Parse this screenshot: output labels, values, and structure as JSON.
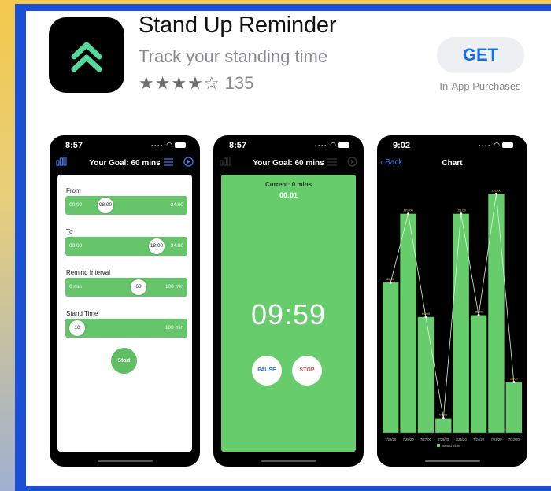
{
  "app": {
    "title": "Stand Up Reminder",
    "subtitle": "Track your standing time",
    "stars": "★★★★☆",
    "rating_count": "135",
    "get_label": "GET",
    "iap_label": "In-App Purchases",
    "icon": "double-chevron-up-icon",
    "icon_color": "#54d99a"
  },
  "screens": [
    {
      "status_time": "8:57",
      "nav_title": "Your Goal: 60 mins",
      "settings": [
        {
          "label": "From",
          "min": "00:00",
          "knob": "08:00",
          "max": "24:00",
          "pos": 0.33
        },
        {
          "label": "To",
          "min": "00:00",
          "knob": "18:00",
          "max": "24:00",
          "pos": 0.75
        },
        {
          "label": "Remind Interval",
          "min": "0 min",
          "knob": "60",
          "max": "100 min",
          "pos": 0.6
        },
        {
          "label": "Stand Time",
          "min": "",
          "knob": "10",
          "max": "100 min",
          "pos": 0.1
        }
      ],
      "start_label": "Start"
    },
    {
      "status_time": "8:57",
      "nav_title": "Your Goal: 60 mins",
      "current": "Current: 0 mins",
      "elapsed": "00:01",
      "countdown": "09:59",
      "pause_label": "PAUSE",
      "stop_label": "STOP"
    },
    {
      "status_time": "9:02",
      "back_label": "Back",
      "nav_title": "Chart",
      "legend": "Stand Time"
    }
  ],
  "chart_data": {
    "type": "bar",
    "categories": [
      "7/29/20",
      "7/28/20",
      "7/27/00",
      "7/26/20",
      "7/25/20",
      "7/24/20",
      "7/23/20",
      "7/22/20"
    ],
    "values": [
      83,
      121,
      64,
      8,
      121,
      65,
      132,
      28
    ],
    "value_labels": [
      "83.00",
      "121.00",
      "64.00",
      "08.00",
      "121.00",
      "65.00",
      "132.00",
      "28.00"
    ],
    "series": [
      {
        "name": "Stand Time",
        "values": [
          83,
          121,
          64,
          8,
          121,
          65,
          132,
          28
        ]
      }
    ],
    "bar_color": "#67cc6c",
    "ylim": [
      0,
      140
    ]
  },
  "colors": {
    "frame": "#1a4fd6",
    "green": "#67cc6c",
    "link": "#1470e8"
  }
}
